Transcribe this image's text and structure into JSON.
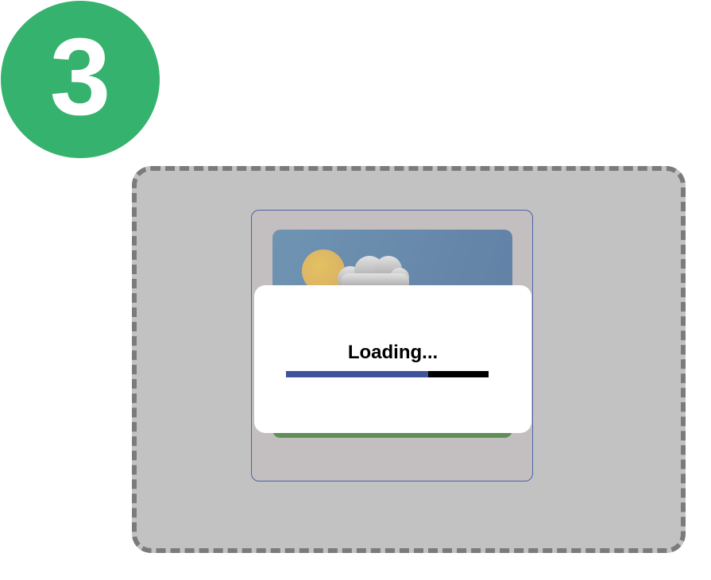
{
  "step": {
    "number": "3",
    "color": "#35b26d"
  },
  "loading_dialog": {
    "text": "Loading...",
    "progress": 0.7,
    "progress_color": "#3e5398",
    "track_color": "#000000"
  },
  "image_placeholder": {
    "icon": "landscape-image-icon"
  }
}
